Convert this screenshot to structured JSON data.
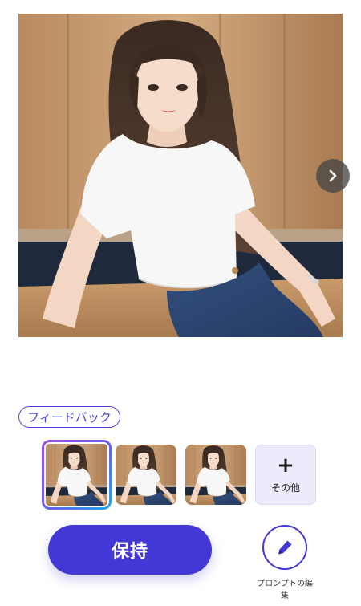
{
  "image": {
    "description_icon": "portrait-photo",
    "next_icon": "chevron-right-icon"
  },
  "feedback": {
    "label": "フィードバック"
  },
  "thumbnails": {
    "items": [
      {
        "state": "selected"
      },
      {
        "state": "default"
      },
      {
        "state": "default"
      }
    ],
    "more_label": "その他",
    "more_icon": "plus-icon"
  },
  "actions": {
    "keep_label": "保持",
    "edit_label": "プロンプトの編集",
    "edit_icon": "pen-icon"
  },
  "colors": {
    "accent": "#4338d6",
    "selected_gradient_start": "#a64be0",
    "selected_gradient_end": "#1ea8f0",
    "more_tile_bg": "#ecebfb"
  }
}
